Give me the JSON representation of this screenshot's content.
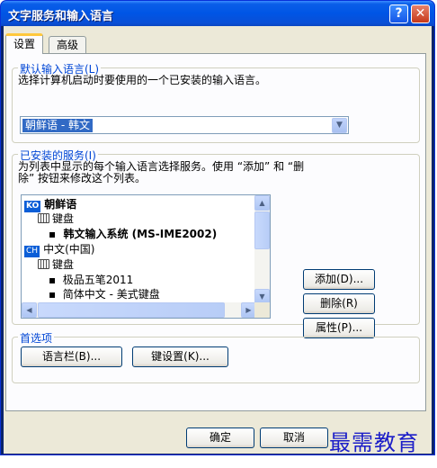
{
  "window": {
    "title": "文字服务和输入语言"
  },
  "tabs": [
    {
      "label": "设置"
    },
    {
      "label": "高级"
    }
  ],
  "default_language": {
    "legend": "默认输入语言(L)",
    "description": "选择计算机启动时要使用的一个已安装的输入语言。",
    "selected": "朝鲜语 - 韩文"
  },
  "installed_services": {
    "legend": "已安装的服务(I)",
    "description_line1": "为列表中显示的每个输入语言选择服务。使用 “添加” 和 “删",
    "description_line2": "除” 按钮来修改这个列表。",
    "tree": {
      "lang1": {
        "code": "KO",
        "name": "朝鲜语"
      },
      "lang1_keyboard": "键盘",
      "lang1_item": "韩文输入系统 (MS-IME2002)",
      "lang2": {
        "code": "CH",
        "name": "中文(中国)"
      },
      "lang2_keyboard": "键盘",
      "lang2_item1": "极品五笔2011",
      "lang2_item2": "简体中文 - 美式键盘"
    },
    "add_button": "添加(D)...",
    "remove_button": "删除(R)",
    "properties_button": "属性(P)..."
  },
  "preferences": {
    "legend": "首选项",
    "language_bar_button": "语言栏(B)...",
    "key_settings_button": "键设置(K)..."
  },
  "footer": {
    "ok": "确定",
    "cancel": "取消"
  },
  "watermark": "最需教育",
  "colors": {
    "title_bar": "#0055e5",
    "selection": "#316ac5",
    "legend": "#0046d5",
    "watermark": "#1c1ec8"
  }
}
